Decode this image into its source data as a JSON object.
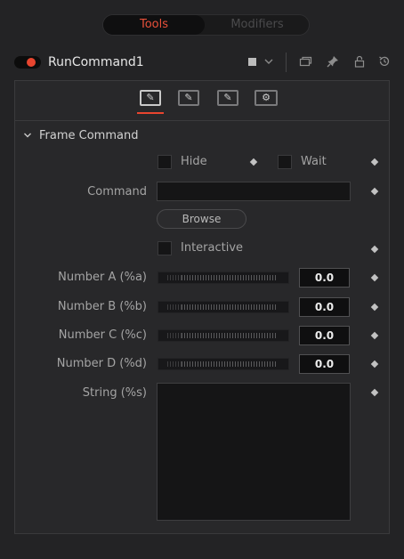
{
  "tabs": {
    "tools": "Tools",
    "modifiers": "Modifiers"
  },
  "tool": {
    "name": "RunCommand1",
    "enabled": true,
    "color_swatch": "#bcbcbc"
  },
  "header_icons": [
    "chevron-down-icon",
    "window-icon",
    "pin-icon",
    "lock-icon",
    "reset-icon"
  ],
  "control_tabs": [
    {
      "name": "frame-tab",
      "glyph": "✎",
      "active": true
    },
    {
      "name": "start-tab",
      "glyph": "✎",
      "active": false
    },
    {
      "name": "end-tab",
      "glyph": "✎",
      "active": false
    },
    {
      "name": "settings-tab",
      "glyph": "⚙",
      "active": false
    }
  ],
  "section": {
    "title": "Frame Command",
    "expanded": true
  },
  "controls": {
    "hide_label": "Hide",
    "hide_checked": false,
    "wait_label": "Wait",
    "wait_checked": false,
    "command_label": "Command",
    "command_value": "",
    "browse_label": "Browse",
    "interactive_label": "Interactive",
    "interactive_checked": false,
    "numbers": [
      {
        "label": "Number A (%a)",
        "value": "0.0"
      },
      {
        "label": "Number B (%b)",
        "value": "0.0"
      },
      {
        "label": "Number C (%c)",
        "value": "0.0"
      },
      {
        "label": "Number D (%d)",
        "value": "0.0"
      }
    ],
    "string_label": "String (%s)",
    "string_value": ""
  },
  "colors": {
    "accent": "#e8452f",
    "tab_active_text": "#e8503a",
    "background": "#232325"
  }
}
